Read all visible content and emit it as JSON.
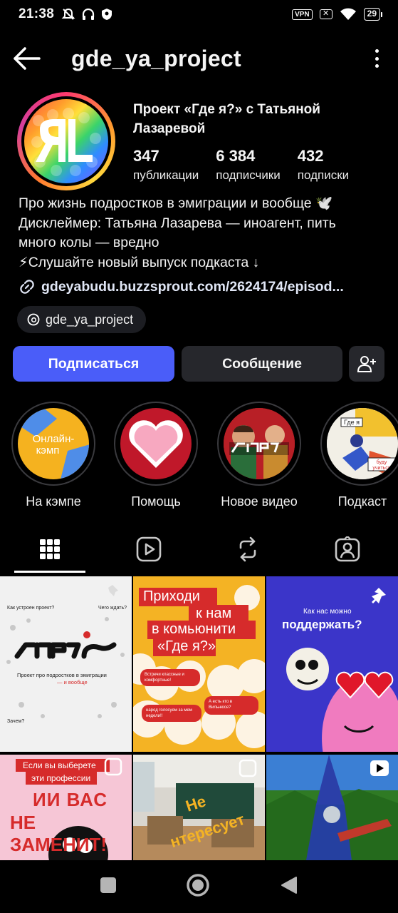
{
  "status_bar": {
    "time": "21:38",
    "vpn": "VPN",
    "battery": "29"
  },
  "header": {
    "title": "gde_ya_project"
  },
  "profile": {
    "full_name": "Проект «Где я?» с Татьяной Лазаревой",
    "stats": [
      {
        "value": "347",
        "label": "публикации"
      },
      {
        "value": "6 384",
        "label": "подписчики"
      },
      {
        "value": "432",
        "label": "подписки"
      }
    ],
    "bio_lines": [
      "Про жизнь подростков в эмиграции и вообще 🕊️",
      "Дисклеймер: Татьяна Лазарева — иноагент, пить",
      "много колы — вредно",
      "⚡Слушайте новый выпуск подкаста ↓"
    ],
    "link": "gdeyabudu.buzzsprout.com/2624174/episod...",
    "threads_handle": "gde_ya_project"
  },
  "actions": {
    "follow": "Подписаться",
    "message": "Сообщение"
  },
  "highlights": [
    {
      "label": "На кэмпе",
      "cover_text": "Онлайн-кэмп"
    },
    {
      "label": "Помощь"
    },
    {
      "label": "Новое видео"
    },
    {
      "label": "Подкаст",
      "cover_text_1": "Где я",
      "cover_text_2": "буду учиться"
    }
  ],
  "grid_posts": {
    "post1": {
      "q1": "Как устроен проект?",
      "q2": "Чего ждать?",
      "logo": "ГДЕЯ?",
      "caption": "Проект про подростков в эмиграции",
      "caption_accent": "— и вообще",
      "q3": "Зачем?"
    },
    "post2": {
      "line1": "Приходи",
      "line2": "к нам",
      "line3": "в комьюнити",
      "line4": "«Где я?»",
      "bubble1": "Встречи классные и комфортные!",
      "bubble2": "А есть кто в Вильнюсе?",
      "bubble3": "народ голосуем за мем недели!!"
    },
    "post3": {
      "line1": "Как нас можно",
      "line2": "поддержать?"
    },
    "post4": {
      "line1": "Если вы выберете",
      "line2": "эти профессии",
      "line3": "ИИ ВАС",
      "line4": "НЕ ЗАМЕНИТ!"
    },
    "post5": {
      "line1": "Не",
      "line2": "нтересует"
    }
  },
  "colors": {
    "accent_blue": "#4a5df9",
    "button_dark": "#26272c",
    "background": "#000000"
  }
}
